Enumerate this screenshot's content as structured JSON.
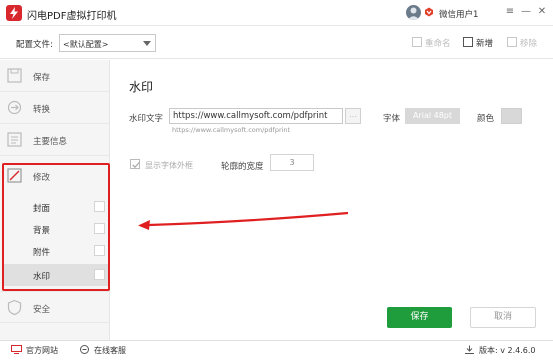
{
  "app": {
    "title": "闪电PDF虚拟打印机",
    "user_name": "微信用户1"
  },
  "window_controls": {
    "menu": "≡",
    "minimize": "—",
    "close": "✕"
  },
  "config": {
    "label": "配置文件:",
    "selected": "<默认配置>",
    "rename_label": "重命名",
    "new_label": "新增",
    "remove_label": "移除"
  },
  "sidebar": {
    "items": [
      {
        "label": "保存",
        "icon": "save-icon"
      },
      {
        "label": "转换",
        "icon": "convert-icon"
      },
      {
        "label": "主要信息",
        "icon": "info-icon"
      },
      {
        "label": "修改",
        "icon": "edit-icon"
      },
      {
        "label": "安全",
        "icon": "shield-icon"
      }
    ],
    "sub_items": [
      {
        "label": "封面"
      },
      {
        "label": "背景"
      },
      {
        "label": "附件"
      },
      {
        "label": "水印",
        "selected": true
      }
    ]
  },
  "main": {
    "section_title": "水印",
    "watermark_text_label": "水印文字",
    "watermark_text_value": "https://www.callmysoft.com/pdfprint",
    "watermark_button": "…",
    "watermark_hint": "https://www.callmysoft.com/pdfprint",
    "font_label": "字体",
    "font_value": "Arial 48pt",
    "color_label": "颜色",
    "outline_label": "显示字体外框",
    "outline_checked": true,
    "outline_width_label": "轮廓的宽度",
    "outline_width_value": "3",
    "save_button": "保存",
    "cancel_button": "取消"
  },
  "footer": {
    "website_label": "官方网站",
    "support_label": "在线客服",
    "version_label": "版本: v 2.4.6.0"
  },
  "colors": {
    "accent_green": "#1f9d3d",
    "highlight_red": "#e02020",
    "logo_red": "#d9272e"
  }
}
